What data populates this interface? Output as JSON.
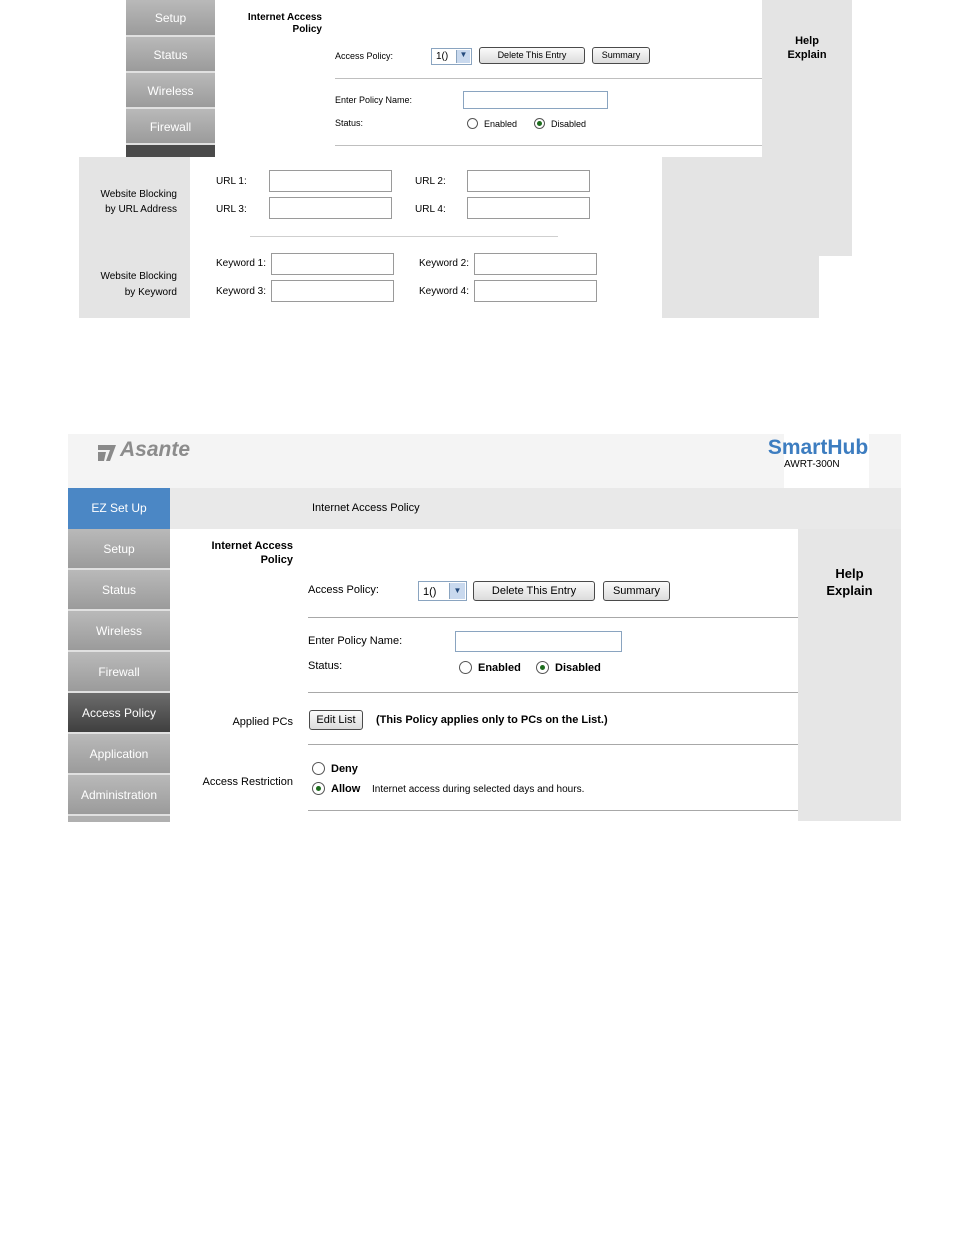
{
  "top_panel": {
    "nav_items": [
      {
        "label": "Setup"
      },
      {
        "label": "Status"
      },
      {
        "label": "Wireless"
      },
      {
        "label": "Firewall"
      }
    ],
    "section_title": "Internet Access",
    "section_title_2": "Policy",
    "access_policy_label": "Access Policy:",
    "access_policy_value": "1()",
    "delete_label": "Delete This Entry",
    "summary_label": "Summary",
    "policy_name_label": "Enter Policy Name:",
    "policy_name_value": "",
    "status_label": "Status:",
    "enabled_label": "Enabled",
    "disabled_label": "Disabled",
    "help_label": "Help",
    "explain_label": "Explain",
    "url_block_label_1": "Website Blocking",
    "url_block_label_2": "by URL Address",
    "url_fields": [
      {
        "label": "URL 1:",
        "value": ""
      },
      {
        "label": "URL 2:",
        "value": ""
      },
      {
        "label": "URL 3:",
        "value": ""
      },
      {
        "label": "URL 4:",
        "value": ""
      }
    ],
    "kw_block_label_1": "Website Blocking",
    "kw_block_label_2": "by Keyword",
    "keyword_fields": [
      {
        "label": "Keyword 1:",
        "value": ""
      },
      {
        "label": "Keyword 2:",
        "value": ""
      },
      {
        "label": "Keyword 3:",
        "value": ""
      },
      {
        "label": "Keyword 4:",
        "value": ""
      }
    ]
  },
  "bottom_panel": {
    "brand_logo": "Asante",
    "product_name": "SmartHub",
    "product_model": "AWRT-300N",
    "nav_items": [
      {
        "label": "EZ Set Up"
      },
      {
        "label": "Setup"
      },
      {
        "label": "Status"
      },
      {
        "label": "Wireless"
      },
      {
        "label": "Firewall"
      },
      {
        "label": "Access Policy"
      },
      {
        "label": "Application"
      },
      {
        "label": "Administration"
      }
    ],
    "breadcrumb": "Internet Access Policy",
    "section_title": "Internet Access",
    "section_title_2": "Policy",
    "access_policy_label": "Access Policy:",
    "access_policy_value": "1()",
    "delete_label": "Delete This Entry",
    "summary_label": "Summary",
    "policy_name_label": "Enter Policy Name:",
    "policy_name_value": "",
    "status_label": "Status:",
    "enabled_label": "Enabled",
    "disabled_label": "Disabled",
    "applied_pcs_label": "Applied PCs",
    "edit_list_label": "Edit List",
    "applied_note": "(This Policy applies only to PCs on the List.)",
    "restriction_label": "Access Restriction",
    "deny_label": "Deny",
    "allow_label": "Allow",
    "allow_desc": "Internet access during selected days and hours.",
    "help_label": "Help",
    "explain_label": "Explain"
  }
}
